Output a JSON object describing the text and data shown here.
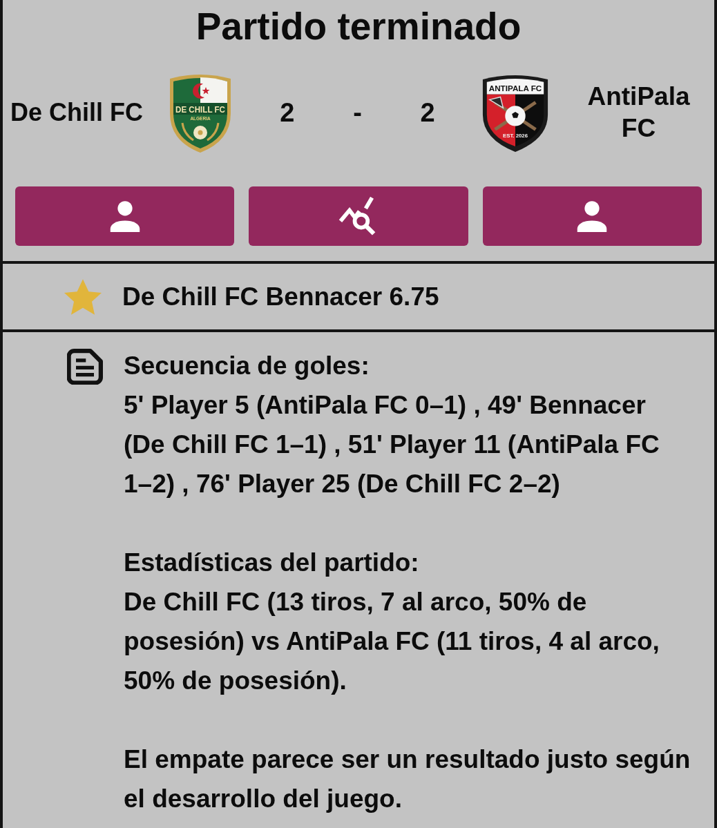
{
  "title": "Partido terminado",
  "match": {
    "home": {
      "name": "De Chill FC",
      "crest": {
        "title": "DE CHILL FC",
        "subtitle": "ALGERIA"
      }
    },
    "score": {
      "home": "2",
      "separator": "-",
      "away": "2"
    },
    "away": {
      "name": "AntiPala FC",
      "crest": {
        "title": "ANTIPALA FC",
        "subtitle": "EST. 2026"
      }
    }
  },
  "buttons": [
    {
      "kind": "home_players"
    },
    {
      "kind": "stats"
    },
    {
      "kind": "away_players"
    }
  ],
  "highlight": {
    "text": "De Chill FC Bennacer 6.75"
  },
  "summary": [
    {
      "heading": "Secuencia de goles:",
      "text": "5' Player 5 (AntiPala FC 0–1) , 49' Bennacer (De Chill FC 1–1) , 51' Player 11 (AntiPala FC 1–2) , 76' Player 25 (De Chill FC 2–2)"
    },
    {
      "heading": "Estadísticas del partido:",
      "text": "De Chill FC (13 tiros, 7 al arco, 50% de posesión) vs AntiPala FC (11 tiros, 4 al arco, 50% de posesión)."
    },
    {
      "text": "El empate parece ser un resultado justo según el desarrollo del juego."
    }
  ]
}
